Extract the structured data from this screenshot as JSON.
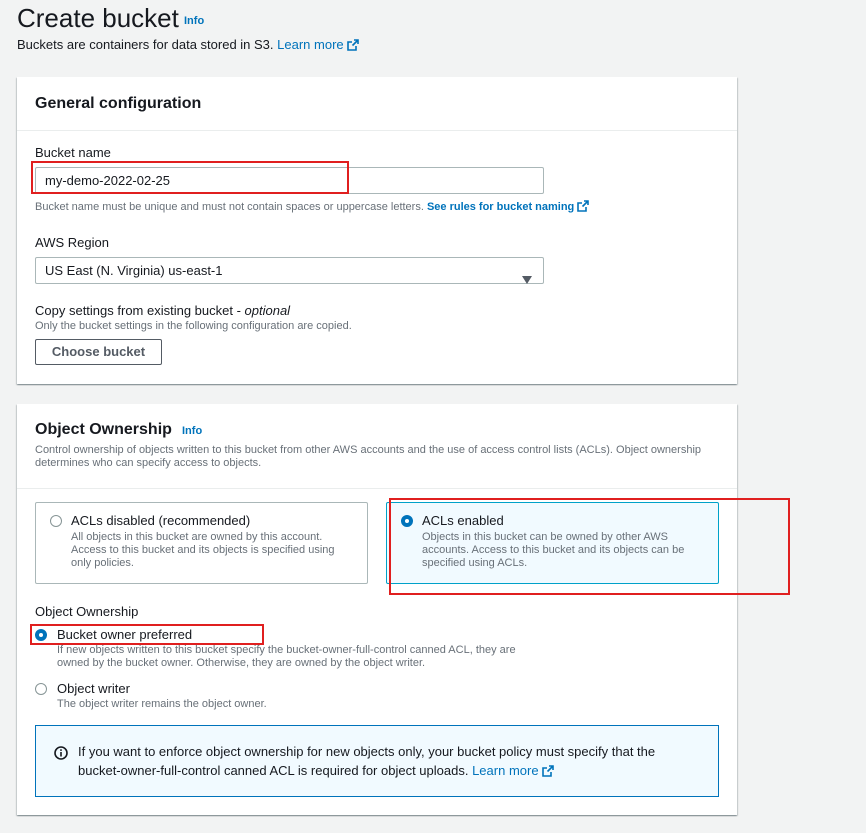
{
  "header": {
    "title": "Create bucket",
    "info": "Info",
    "subtitle": "Buckets are containers for data stored in S3.",
    "learn_more": "Learn more"
  },
  "general": {
    "heading": "General configuration",
    "bucket_name_label": "Bucket name",
    "bucket_name_value": "my-demo-2022-02-25",
    "bucket_name_hint": "Bucket name must be unique and must not contain spaces or uppercase letters.",
    "rules_link": "See rules for bucket naming",
    "region_label": "AWS Region",
    "region_value": "US East (N. Virginia) us-east-1",
    "copy_label": "Copy settings from existing bucket - ",
    "copy_optional": "optional",
    "copy_hint": "Only the bucket settings in the following configuration are copied.",
    "choose_button": "Choose bucket"
  },
  "ownership": {
    "heading": "Object Ownership",
    "info": "Info",
    "desc_line1": "Control ownership of objects written to this bucket from other AWS accounts and the use of access control lists (ACLs). Object ownership",
    "desc_line2": "determines who can specify access to objects.",
    "tiles": [
      {
        "title": "ACLs disabled (recommended)",
        "desc": [
          "All objects in this bucket are owned by this account.",
          "Access to this bucket and its objects is specified using",
          "only policies."
        ],
        "selected": false
      },
      {
        "title": "ACLs enabled",
        "desc": [
          "Objects in this bucket can be owned by other AWS",
          "accounts. Access to this bucket and its objects can be",
          "specified using ACLs."
        ],
        "selected": true
      }
    ],
    "sub_label": "Object Ownership",
    "options": [
      {
        "title": "Bucket owner preferred",
        "desc": [
          "If new objects written to this bucket specify the bucket-owner-full-control canned ACL, they are",
          "owned by the bucket owner. Otherwise, they are owned by the object writer."
        ],
        "selected": true
      },
      {
        "title": "Object writer",
        "desc": [
          "The object writer remains the object owner."
        ],
        "selected": false
      }
    ],
    "alert_line1": "If you want to enforce object ownership for new objects only, your bucket policy must specify that the",
    "alert_line2": "bucket-owner-full-control canned ACL is required for object uploads.",
    "alert_link": "Learn more"
  },
  "colors": {
    "link": "#0073bb",
    "highlight": "#e01f1f",
    "selected_bg": "#f1faff"
  }
}
